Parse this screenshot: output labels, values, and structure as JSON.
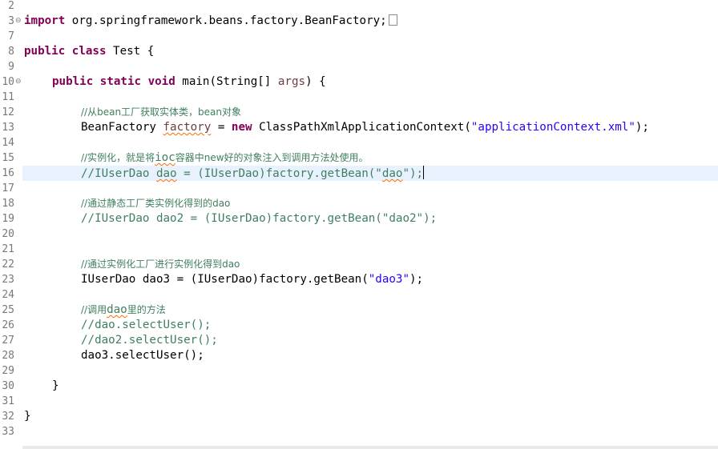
{
  "editor": {
    "lines": {
      "l2": "2",
      "l3": "3",
      "l7": "7",
      "l8": "8",
      "l9": "9",
      "l10": "10",
      "l11": "11",
      "l12": "12",
      "l13": "13",
      "l14": "14",
      "l15": "15",
      "l16": "16",
      "l17": "17",
      "l18": "18",
      "l19": "19",
      "l20": "20",
      "l21": "21",
      "l22": "22",
      "l23": "23",
      "l24": "24",
      "l25": "25",
      "l26": "26",
      "l27": "27",
      "l28": "28",
      "l29": "29",
      "l30": "30",
      "l31": "31",
      "l32": "32",
      "l33": "33"
    },
    "code": {
      "import_kw": "import",
      "import_path": " org.springframework.beans.factory.BeanFactory;",
      "public_kw": "public",
      "class_kw": "class",
      "class_name": " Test {",
      "static_kw": "static",
      "void_kw": "void",
      "main_sig": " main(String[] ",
      "args": "args",
      "main_tail": ") {",
      "c12_a": "//从bean工厂获取实体类，bean对象",
      "l13_type": "BeanFactory ",
      "l13_var": "factory",
      "l13_eq": " = ",
      "new_kw": "new",
      "l13_ctor": " ClassPathXmlApplicationContext(",
      "l13_str": "\"applicationContext.xml\"",
      "l13_end": ");",
      "c15_a": "//实例化，就是将",
      "c15_ioc": "ioc",
      "c15_b": "容器中new好的对象注入到调用方法处使用。",
      "c16_a": "//IUserDao ",
      "c16_dao": "dao",
      "c16_b": " = (IUserDao)factory.getBean(\"",
      "c16_dao2": "dao",
      "c16_c": "\");",
      "c18": "//通过静态工厂类实例化得到的dao",
      "c19": "//IUserDao dao2 = (IUserDao)factory.getBean(\"dao2\");",
      "c22": "//通过实例化工厂进行实例化得到dao",
      "l23_a": "IUserDao dao3 = (IUserDao)factory.getBean(",
      "l23_str": "\"dao3\"",
      "l23_end": ");",
      "c25_a": "//调用",
      "c25_dao": "dao",
      "c25_b": "里的方法",
      "c26": "//dao.selectUser();",
      "c27": "//dao2.selectUser();",
      "l28": "dao3.selectUser();",
      "close_method": "}",
      "close_class": "}"
    },
    "fold_icon_symbol": "⊖",
    "colors": {
      "keyword": "#7f0055",
      "comment": "#3f7f5f",
      "string": "#2a00ff",
      "line_number": "#787878",
      "current_line": "#e8f2fe"
    }
  }
}
